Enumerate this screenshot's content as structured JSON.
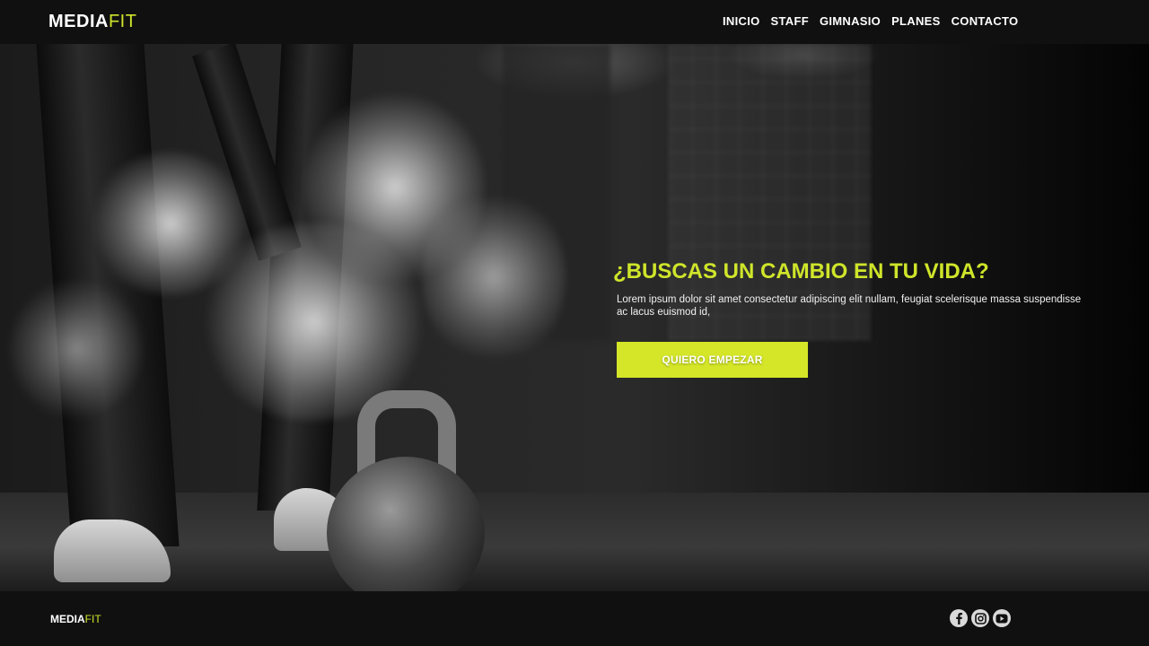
{
  "header": {
    "logo_part1": "MEDIA",
    "logo_part2": "FIT",
    "nav": [
      "INICIO",
      "STAFF",
      "GIMNASIO",
      "PLANES",
      "CONTACTO"
    ]
  },
  "hero": {
    "title": "¿BUSCAS UN CAMBIO EN TU VIDA?",
    "text": "Lorem ipsum dolor sit amet consectetur adipiscing elit nullam, feugiat scelerisque massa suspendisse ac lacus euismod id,",
    "cta_label": "QUIERO EMPEZAR"
  },
  "footer": {
    "logo_part1": "MEDIA",
    "logo_part2": "FIT",
    "social_icons": [
      "facebook-icon",
      "instagram-icon",
      "youtube-icon"
    ]
  },
  "colors": {
    "accent": "#cfe52a",
    "button": "#d4e627",
    "background": "#101010"
  }
}
